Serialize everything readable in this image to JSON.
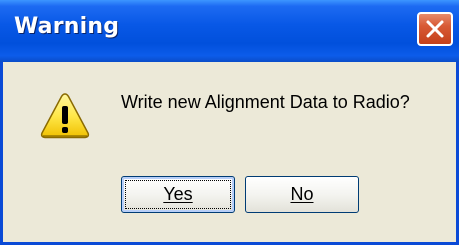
{
  "window": {
    "title": "Warning",
    "close_icon": "close-icon"
  },
  "dialog": {
    "icon": "warning-icon",
    "message": "Write new Alignment Data to Radio?"
  },
  "buttons": {
    "yes_label": "Yes",
    "no_label": "No"
  },
  "colors": {
    "titlebar": "#0858e6",
    "close_button": "#d85a35",
    "body": "#ece9d8",
    "warning_fill": "#ffe84a"
  }
}
